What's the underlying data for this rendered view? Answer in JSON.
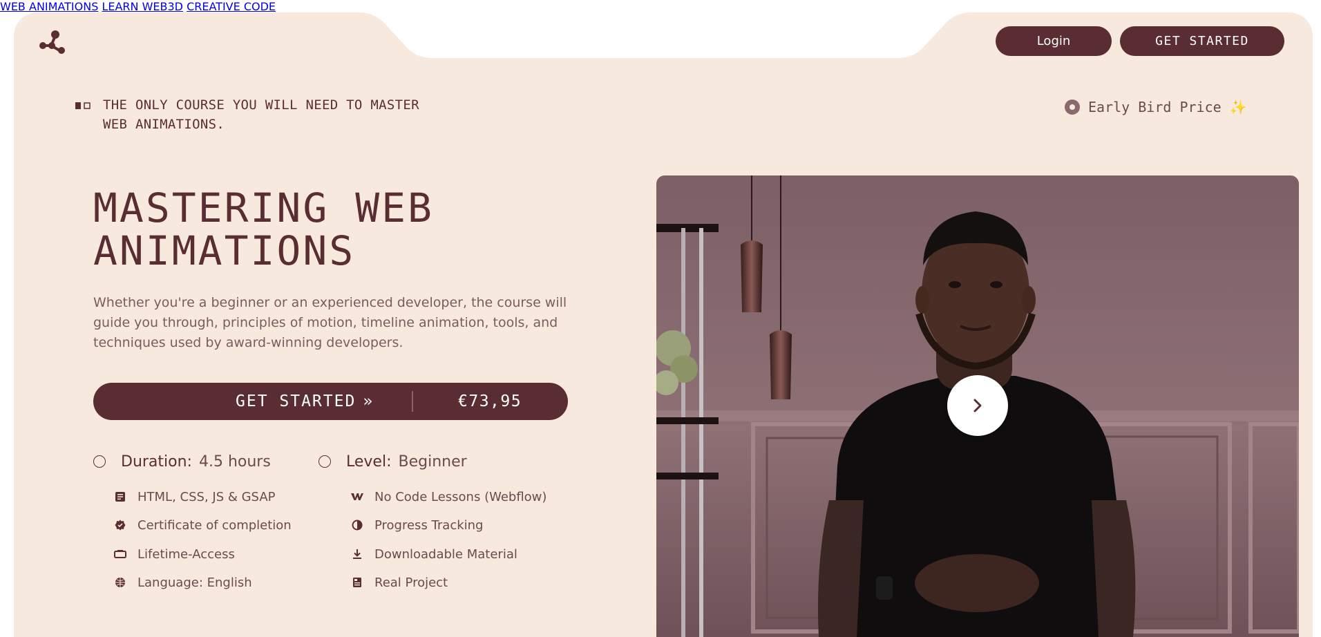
{
  "nav": {
    "links": [
      "WEB ANIMATIONS",
      "LEARN WEB3D",
      "CREATIVE CODE"
    ],
    "login_label": "Login",
    "get_started_label": "GET STARTED"
  },
  "hero": {
    "tagline": "THE ONLY COURSE YOU WILL NEED TO MASTER WEB ANIMATIONS.",
    "badge": "Early Bird Price",
    "title_line1": "MASTERING WEB",
    "title_line2": "ANIMATIONS",
    "description": "Whether you're a beginner or an experienced developer, the course will guide you through, principles of motion, timeline animation, tools, and techniques used by award-winning developers.",
    "cta_label": "GET STARTED",
    "cta_price": "€73,95"
  },
  "meta": {
    "duration_label": "Duration:",
    "duration_value": "4.5 hours",
    "level_label": "Level:",
    "level_value": "Beginner"
  },
  "features_left": [
    {
      "icon": "code-icon",
      "text": "HTML, CSS, JS & GSAP"
    },
    {
      "icon": "certificate-icon",
      "text": "Certificate of completion"
    },
    {
      "icon": "infinity-icon",
      "text": "Lifetime-Access"
    },
    {
      "icon": "globe-icon",
      "text": "Language: English"
    }
  ],
  "features_right": [
    {
      "icon": "webflow-icon",
      "text": "No Code Lessons (Webflow)"
    },
    {
      "icon": "progress-icon",
      "text": "Progress Tracking"
    },
    {
      "icon": "download-icon",
      "text": "Downloadable Material"
    },
    {
      "icon": "project-icon",
      "text": "Real Project"
    }
  ],
  "colors": {
    "background": "#f8e9de",
    "brand": "#5a2d33",
    "accent_spark": "#e8a93b"
  }
}
